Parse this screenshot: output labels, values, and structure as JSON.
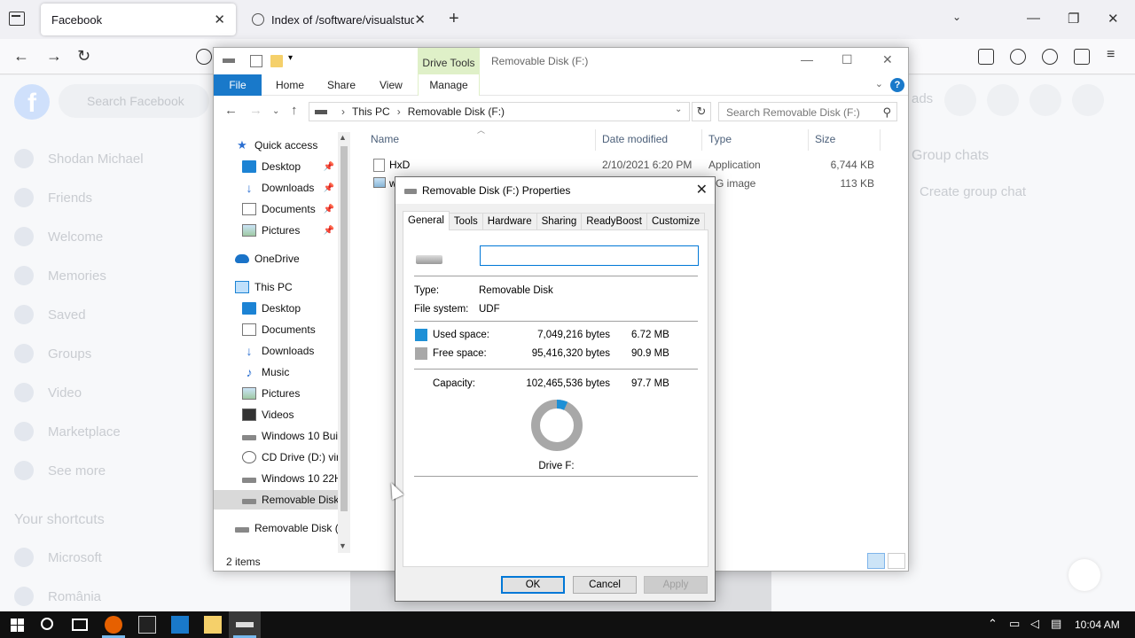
{
  "browser": {
    "tabs": [
      {
        "title": "Facebook",
        "close": "✕"
      },
      {
        "title": "Index of /software/visualstudio",
        "close": "✕"
      }
    ],
    "new_tab": "+",
    "window_controls": {
      "minimize": "—",
      "maximize": "❐",
      "close": "✕"
    },
    "nav": {
      "back": "←",
      "forward": "→",
      "reload": "↻"
    },
    "toolbar_icons": [
      "shield-icon",
      "pocket-icon",
      "sync-icon",
      "account-icon",
      "extensions-icon",
      "menu-icon"
    ]
  },
  "facebook": {
    "search_placeholder": "Search Facebook",
    "sidebar": [
      "Shodan Michael",
      "Friends",
      "Welcome",
      "Memories",
      "Saved",
      "Groups",
      "Video",
      "Marketplace",
      "See more"
    ],
    "shortcuts_heading": "Your shortcuts",
    "shortcuts": [
      "Microsoft",
      "România"
    ],
    "right": {
      "group_chats": "Group chats",
      "create_group_chat": "Create group chat",
      "ads": "ads"
    }
  },
  "explorer": {
    "title": "Removable Disk (F:)",
    "drive_tools": "Drive Tools",
    "ribbon_tabs": [
      "File",
      "Home",
      "Share",
      "View"
    ],
    "manage": "Manage",
    "help": "?",
    "address": {
      "crumbs": [
        "This PC",
        "Removable Disk (F:)"
      ],
      "sep": "›",
      "refresh": "↻"
    },
    "search_placeholder": "Search Removable Disk (F:)",
    "nav_pane": [
      {
        "label": "Quick access",
        "icon": "star-icon",
        "pinned": false
      },
      {
        "label": "Desktop",
        "icon": "desktop-icon",
        "pinned": true
      },
      {
        "label": "Downloads",
        "icon": "download-icon",
        "pinned": true
      },
      {
        "label": "Documents",
        "icon": "documents-icon",
        "pinned": true
      },
      {
        "label": "Pictures",
        "icon": "pictures-icon",
        "pinned": true
      },
      {
        "label": "OneDrive",
        "icon": "cloud-icon",
        "pinned": false
      },
      {
        "label": "This PC",
        "icon": "computer-icon",
        "pinned": false
      },
      {
        "label": "Desktop",
        "icon": "desktop-icon",
        "pinned": false
      },
      {
        "label": "Documents",
        "icon": "documents-icon",
        "pinned": false
      },
      {
        "label": "Downloads",
        "icon": "download-icon",
        "pinned": false
      },
      {
        "label": "Music",
        "icon": "music-icon",
        "pinned": false
      },
      {
        "label": "Pictures",
        "icon": "pictures-icon",
        "pinned": false
      },
      {
        "label": "Videos",
        "icon": "videos-icon",
        "pinned": false
      },
      {
        "label": "Windows 10 Buil",
        "icon": "drive-icon",
        "pinned": false
      },
      {
        "label": "CD Drive (D:) virt",
        "icon": "cd-drive-icon",
        "pinned": false
      },
      {
        "label": "Windows 10 22H",
        "icon": "drive-icon",
        "pinned": false
      },
      {
        "label": "Removable Disk",
        "icon": "removable-drive-icon",
        "pinned": false,
        "selected": true
      },
      {
        "label": "Removable Disk (F",
        "icon": "removable-drive-icon",
        "pinned": false
      }
    ],
    "columns": [
      "Name",
      "Date modified",
      "Type",
      "Size"
    ],
    "files": [
      {
        "name": "HxD",
        "date": "2/10/2021 6:20 PM",
        "type": "Application",
        "size": "6,744 KB"
      },
      {
        "name": "w",
        "date": "",
        "type": "EG image",
        "size": "113 KB"
      }
    ],
    "status": "2 items"
  },
  "properties": {
    "title": "Removable Disk (F:) Properties",
    "close": "✕",
    "tabs": [
      "General",
      "Tools",
      "Hardware",
      "Sharing",
      "ReadyBoost",
      "Customize"
    ],
    "name_value": "",
    "type_label": "Type:",
    "type_value": "Removable Disk",
    "fs_label": "File system:",
    "fs_value": "UDF",
    "used_label": "Used space:",
    "used_bytes": "7,049,216 bytes",
    "used_size": "6.72 MB",
    "free_label": "Free space:",
    "free_bytes": "95,416,320 bytes",
    "free_size": "90.9 MB",
    "capacity_label": "Capacity:",
    "capacity_bytes": "102,465,536 bytes",
    "capacity_size": "97.7 MB",
    "used_fraction": 0.0688,
    "used_color": "#1e90d6",
    "free_color": "#a8a8a8",
    "drive_label": "Drive F:",
    "buttons": {
      "ok": "OK",
      "cancel": "Cancel",
      "apply": "Apply"
    }
  },
  "taskbar": {
    "time": "10:04 AM",
    "apps": [
      "firefox-icon",
      "terminal-icon",
      "settings-icon",
      "file-explorer-icon",
      "removable-drive-icon"
    ]
  }
}
